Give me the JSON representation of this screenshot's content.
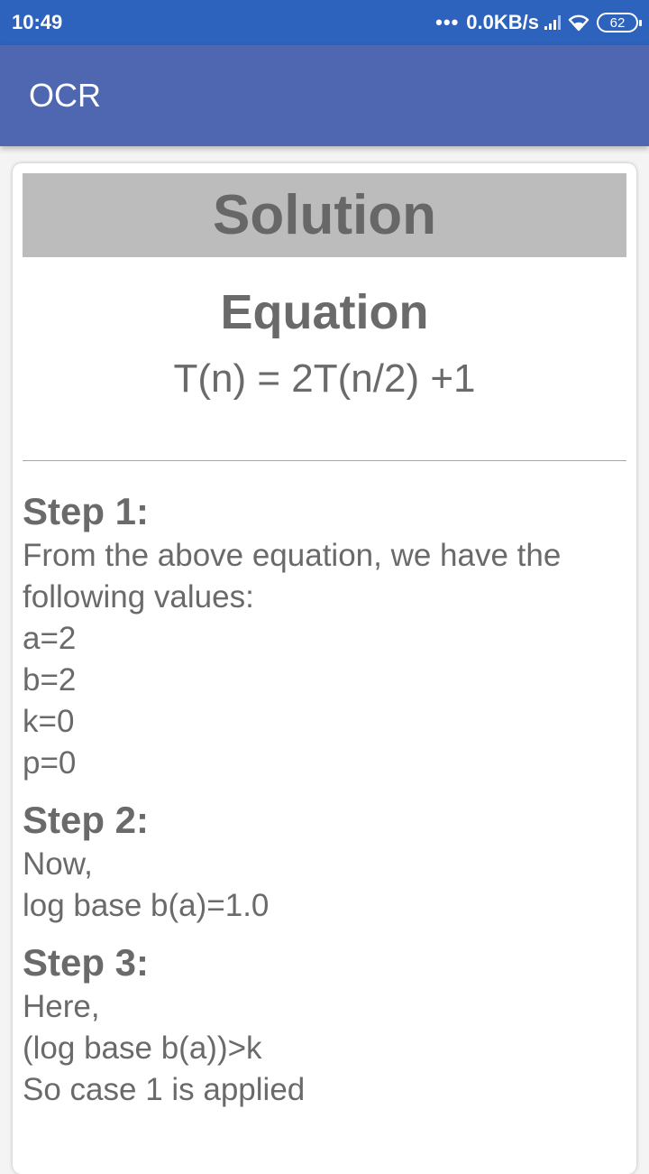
{
  "status_bar": {
    "time": "10:49",
    "dots": "•••",
    "network_speed": "0.0KB/s",
    "battery": "62",
    "color": "#2d62bd"
  },
  "app_bar": {
    "title": "OCR",
    "color": "#4f67b1"
  },
  "card": {
    "header": "Solution",
    "equation_title": "Equation",
    "equation": "T(n) = 2T(n/2) +1",
    "steps": [
      {
        "title": "Step 1:",
        "lines": [
          "From the above equation, we have the",
          "following values:",
          "a=2",
          "b=2",
          "k=0",
          "p=0"
        ]
      },
      {
        "title": "Step 2:",
        "lines": [
          "Now,",
          "log base b(a)=1.0"
        ]
      },
      {
        "title": "Step 3:",
        "lines": [
          "Here,",
          "(log base b(a))>k",
          "So case 1 is applied"
        ]
      }
    ]
  }
}
